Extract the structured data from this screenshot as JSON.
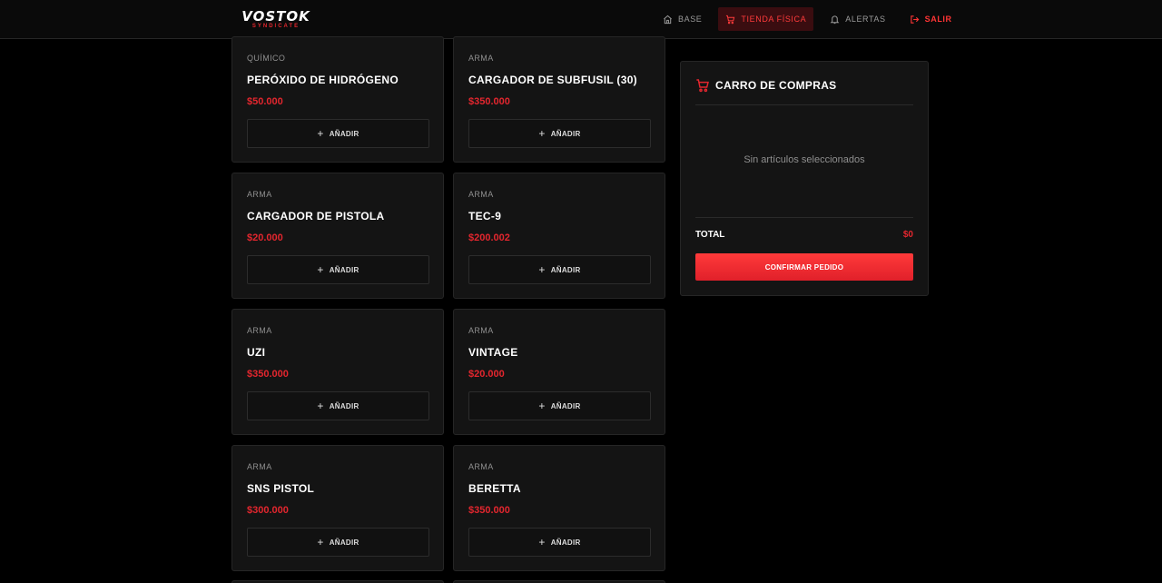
{
  "brand": {
    "name": "VOSTOK",
    "sub": "SYNDICATE"
  },
  "nav": {
    "items": [
      {
        "id": "base",
        "label": "BASE",
        "icon": "home-icon",
        "active": false
      },
      {
        "id": "tienda",
        "label": "TIENDA FÍSICA",
        "icon": "cart-icon",
        "active": true
      },
      {
        "id": "alertas",
        "label": "ALERTAS",
        "icon": "bell-icon",
        "active": false
      },
      {
        "id": "salir",
        "label": "SALIR",
        "icon": "logout-icon",
        "active": false
      }
    ]
  },
  "products": [
    {
      "category": "QUÍMICO",
      "name": "PERÓXIDO DE HIDRÓGENO",
      "price": "$50.000"
    },
    {
      "category": "ARMA",
      "name": "CARGADOR DE SUBFUSIL (30)",
      "price": "$350.000"
    },
    {
      "category": "ARMA",
      "name": "CARGADOR DE PISTOLA",
      "price": "$20.000"
    },
    {
      "category": "ARMA",
      "name": "TEC-9",
      "price": "$200.002"
    },
    {
      "category": "ARMA",
      "name": "UZI",
      "price": "$350.000"
    },
    {
      "category": "ARMA",
      "name": "VINTAGE",
      "price": "$20.000"
    },
    {
      "category": "ARMA",
      "name": "SNS PISTOL",
      "price": "$300.000"
    },
    {
      "category": "ARMA",
      "name": "BERETTA",
      "price": "$350.000"
    }
  ],
  "add_label": "AÑADIR",
  "cart": {
    "title": "CARRO DE COMPRAS",
    "empty_text": "Sin artículos seleccionados",
    "total_label": "TOTAL",
    "total_value": "$0",
    "confirm_label": "CONFIRMAR PEDIDO"
  },
  "colors": {
    "accent": "#e3262e",
    "background": "#000000",
    "card": "#141414"
  }
}
